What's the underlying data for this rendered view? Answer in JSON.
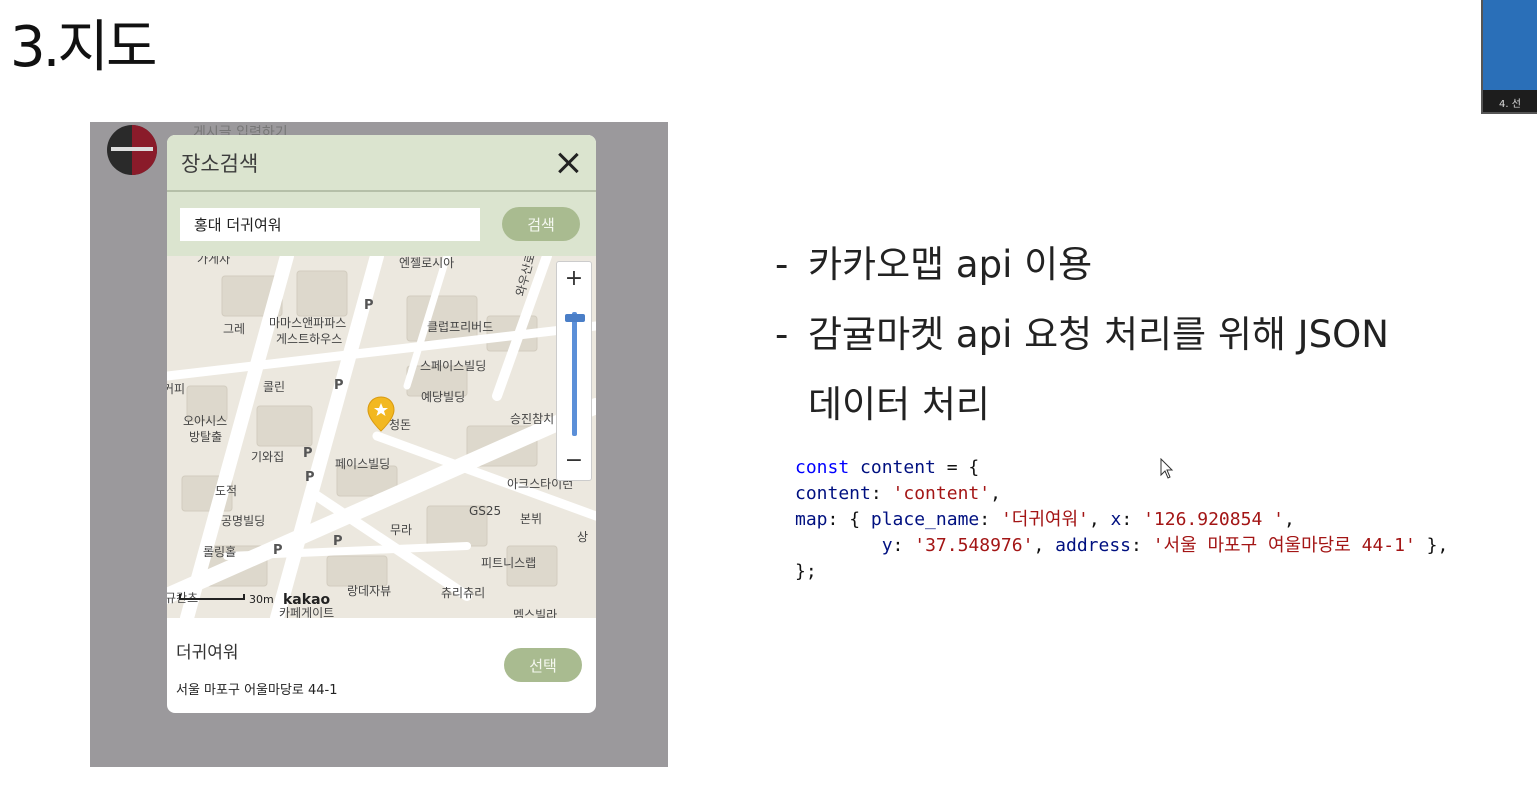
{
  "slide": {
    "title": "3.지도"
  },
  "thumbnail": {
    "label": "4. 선"
  },
  "background_page": {
    "ghost_text": "게시글 입력하기"
  },
  "modal": {
    "title": "장소검색",
    "search": {
      "value": "홍대 더귀여워",
      "button_label": "검색"
    },
    "map": {
      "labels": [
        {
          "text": "가게자",
          "pos": "a"
        },
        {
          "text": "엔젤로시아",
          "pos": "b"
        },
        {
          "text": "그레",
          "pos": "c"
        },
        {
          "text": "마마스앤파파스",
          "pos": "d"
        },
        {
          "text": "게스트하우스",
          "pos": "e"
        },
        {
          "text": "클럽프리버드",
          "pos": "f"
        },
        {
          "text": "스페이스빌딩",
          "pos": "g"
        },
        {
          "text": "콜린",
          "pos": "h"
        },
        {
          "text": "커피",
          "pos": "i"
        },
        {
          "text": "예당빌딩",
          "pos": "j"
        },
        {
          "text": "오아시스",
          "pos": "k"
        },
        {
          "text": "방탈출",
          "pos": "l"
        },
        {
          "text": "승진참치",
          "pos": "m"
        },
        {
          "text": "기와집",
          "pos": "n"
        },
        {
          "text": "페이스빌딩",
          "pos": "o"
        },
        {
          "text": "도적",
          "pos": "p"
        },
        {
          "text": "아크스타이런",
          "pos": "q"
        },
        {
          "text": "GS25",
          "pos": "r"
        },
        {
          "text": "본뷔",
          "pos": "s"
        },
        {
          "text": "공명빌딩",
          "pos": "t"
        },
        {
          "text": "무라",
          "pos": "u"
        },
        {
          "text": "롤링홀",
          "pos": "v"
        },
        {
          "text": "피트니스랩",
          "pos": "w"
        },
        {
          "text": "규칸츠",
          "pos": "x"
        },
        {
          "text": "랑데자뷰",
          "pos": "y"
        },
        {
          "text": "츄리츄리",
          "pos": "z"
        },
        {
          "text": "카페게이트",
          "pos": "aa"
        },
        {
          "text": "멤스빌라",
          "pos": "ab"
        },
        {
          "text": "청돈",
          "pos": "ac"
        },
        {
          "text": "와우산로",
          "pos": "ad"
        },
        {
          "text": "상",
          "pos": "ae"
        }
      ],
      "scale_label": "30m",
      "logo": "kakao",
      "zoom_in": "+",
      "zoom_out": "−"
    },
    "result": {
      "place_name": "더귀여워",
      "address": "서울 마포구 어울마당로 44-1",
      "select_label": "선택"
    }
  },
  "bullets": {
    "line1": "카카오맵 api 이용",
    "line2a": "감귤마켓 api 요청 처리를 위해 JSON",
    "line2b": "데이터 처리",
    "dash": "-"
  },
  "code": {
    "l1_kw": "const",
    "l1_var": "content",
    "l1_rest": " = {",
    "l2_key": "content",
    "l2_val": "'content'",
    "l3_key": "map",
    "l3_pn_key": "place_name",
    "l3_pn_val": "'더귀여워'",
    "l3_x_key": "x",
    "l3_x_val": "'126.920854 '",
    "l4_y_key": "y",
    "l4_y_val": "'37.548976'",
    "l4_addr_key": "address",
    "l4_addr_val": "'서울 마포구 여울마당로 44-1'",
    "l5": "};"
  }
}
